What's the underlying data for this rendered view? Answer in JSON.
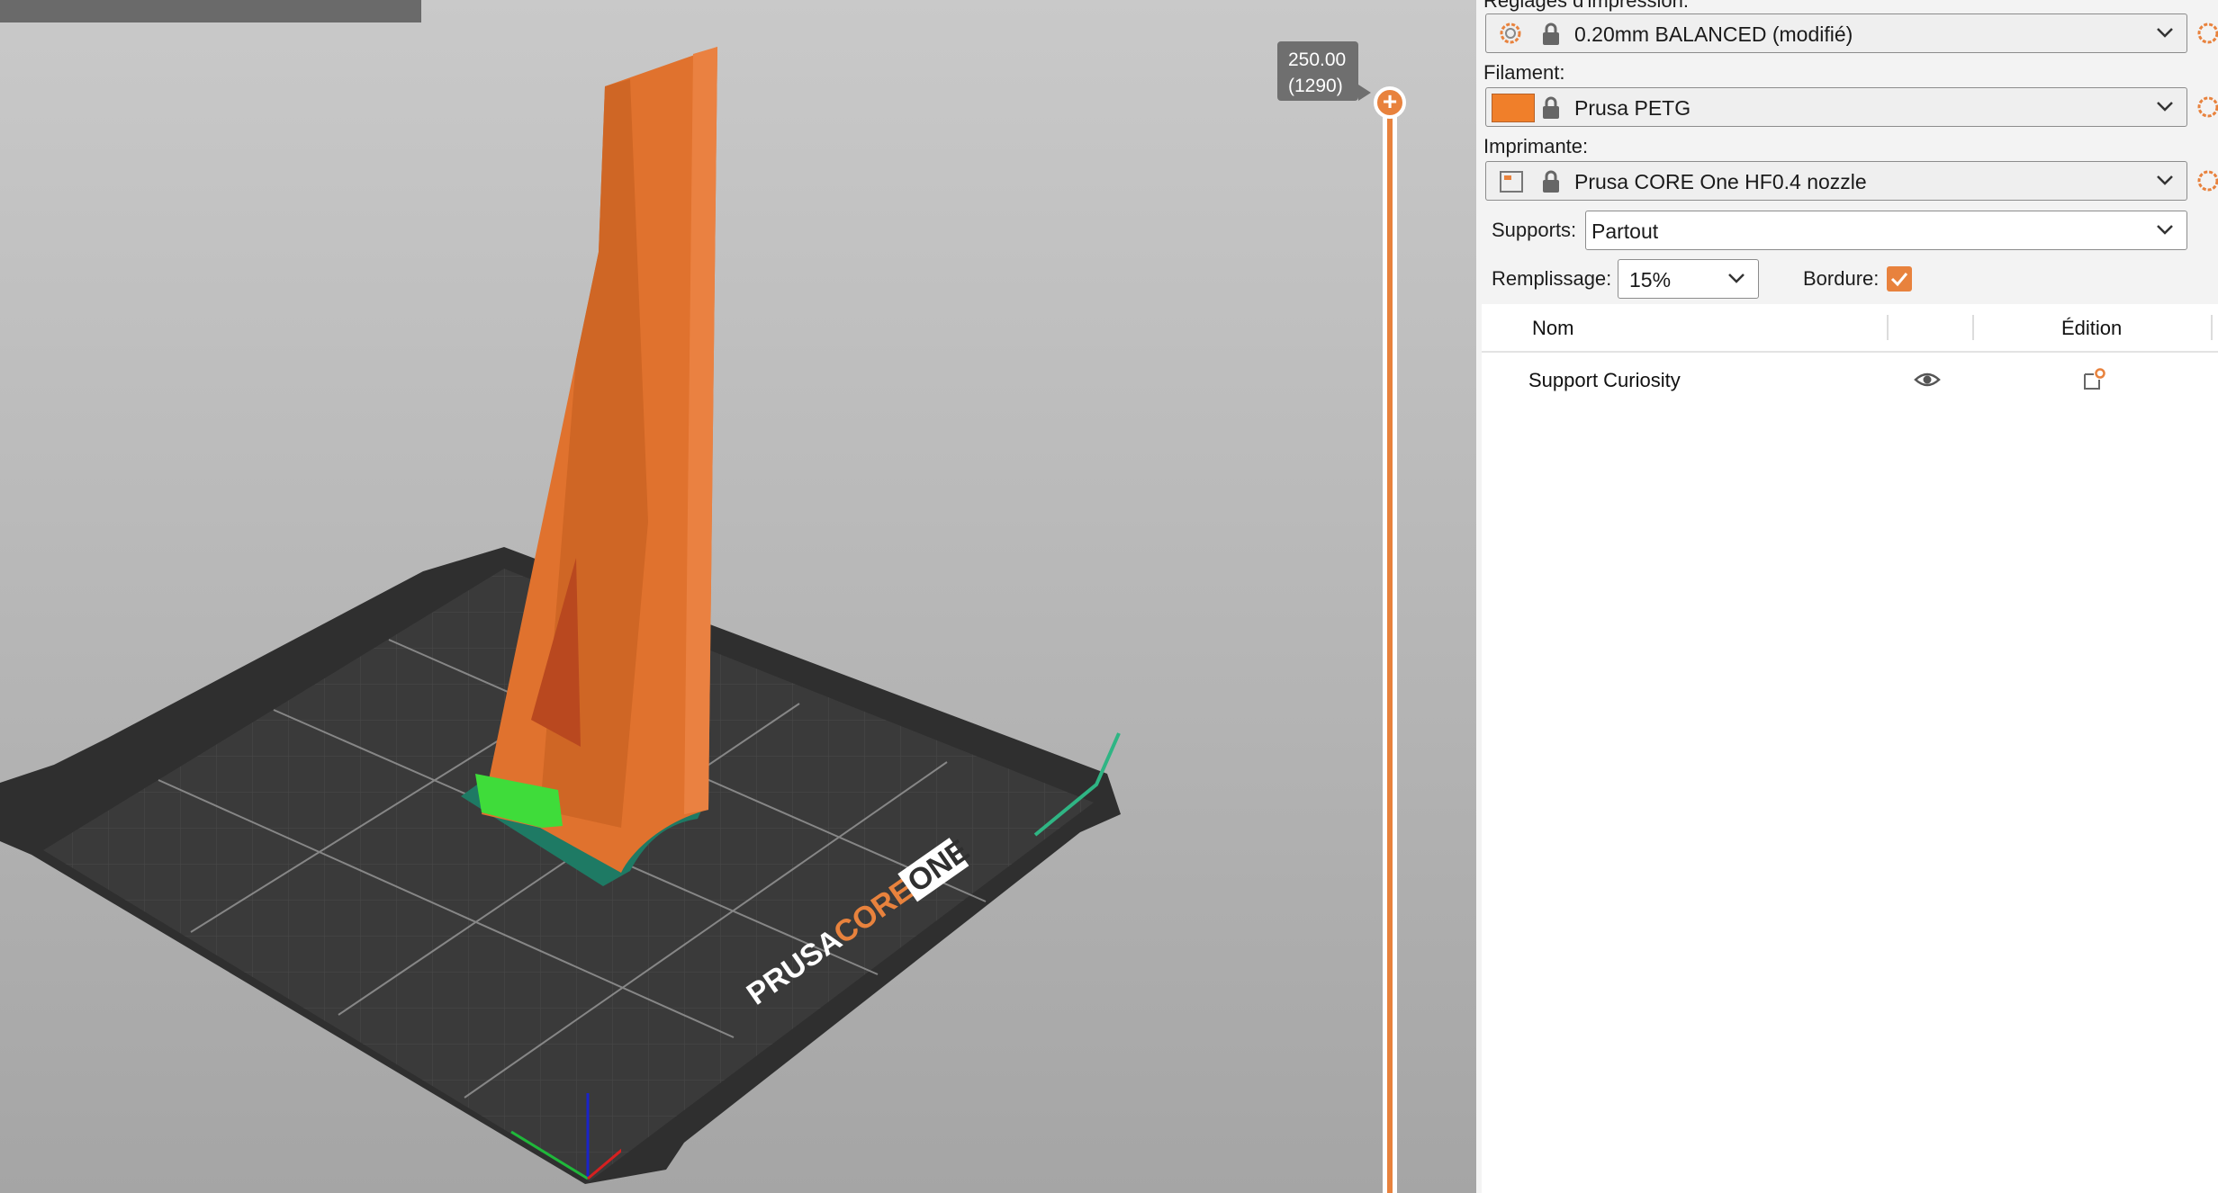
{
  "viewport": {
    "layer_slider": {
      "height_value": "250.00",
      "layer_count": "(1290)",
      "handle_glyph": "+"
    },
    "bed_logo": {
      "word1": "PRUSA",
      "word2": "CORE",
      "word3": "ONE"
    },
    "colors": {
      "model": "#e0722e",
      "support": "#3fdc3a",
      "brim": "#1e7a64",
      "bed": "#2f2f2f",
      "accent": "#e8823d"
    }
  },
  "panel": {
    "print_settings": {
      "label": "Réglages d'impression:",
      "value": "0.20mm BALANCED (modifié)",
      "icon": "gear-icon"
    },
    "filament": {
      "label": "Filament:",
      "value": "Prusa PETG",
      "swatch_color": "#f07f2a"
    },
    "printer": {
      "label": "Imprimante:",
      "value": "Prusa CORE One HF0.4 nozzle",
      "icon": "printer-icon"
    },
    "supports": {
      "label": "Supports:",
      "value": "Partout"
    },
    "infill": {
      "label": "Remplissage:",
      "value": "15%"
    },
    "brim": {
      "label": "Bordure:",
      "checked": true
    },
    "object_list": {
      "headers": {
        "name": "Nom",
        "edit": "Édition"
      },
      "rows": [
        {
          "name": "Support Curiosity",
          "visible_icon": "eye-icon",
          "edit_icon": "edit-settings-icon"
        }
      ]
    }
  }
}
